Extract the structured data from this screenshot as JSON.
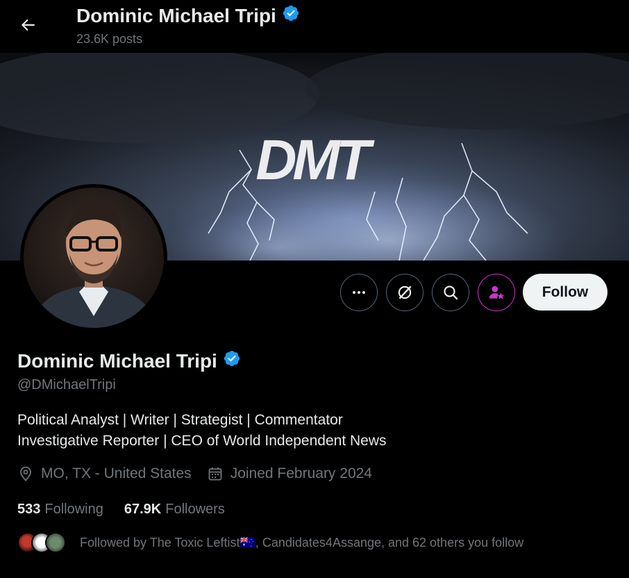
{
  "header": {
    "title": "Dominic Michael Tripi",
    "posts_count": "23.6K posts"
  },
  "banner": {
    "logo_text": "DMT"
  },
  "actions": {
    "follow_label": "Follow"
  },
  "profile": {
    "display_name": "Dominic Michael Tripi",
    "handle": "@DMichaelTripi",
    "bio_line1": "Political Analyst | Writer | Strategist | Commentator",
    "bio_line2": "Investigative Reporter | CEO of World Independent News",
    "location": "MO, TX - United States",
    "joined": "Joined February 2024"
  },
  "stats": {
    "following_count": "533",
    "following_label": "Following",
    "followers_count": "67.9K",
    "followers_label": "Followers"
  },
  "followed_by": {
    "text": "Followed by The Toxic Leftist🇦🇺, Candidates4Assange, and 62 others you follow"
  },
  "colors": {
    "verified": "#1d9bf0",
    "subscribe": "#c936c9",
    "muted_text": "#71767b"
  }
}
